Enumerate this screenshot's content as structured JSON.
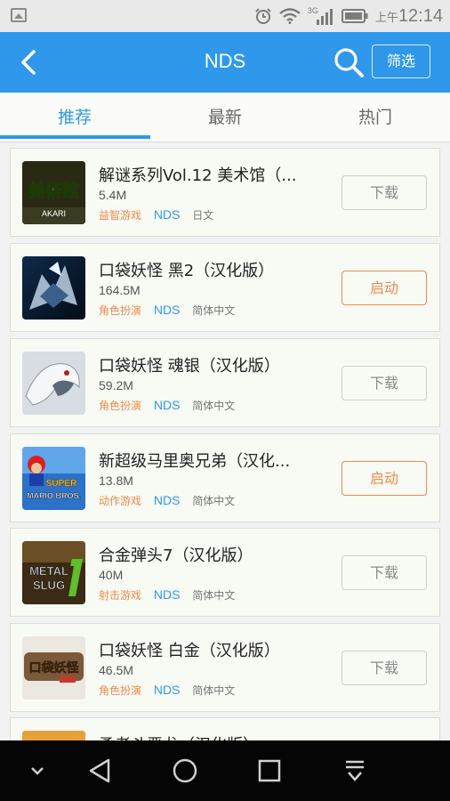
{
  "status_bar": {
    "ampm": "上午",
    "time": "12:14",
    "network": "3G"
  },
  "app_bar": {
    "title": "NDS",
    "filter_label": "筛选"
  },
  "tabs": [
    {
      "label": "推荐",
      "active": true
    },
    {
      "label": "最新",
      "active": false
    },
    {
      "label": "热门",
      "active": false
    }
  ],
  "games": [
    {
      "name": "解谜系列Vol.12 美术馆（...",
      "size": "5.4M",
      "category": "益智游戏",
      "platform": "NDS",
      "language": "日文",
      "action": "下载",
      "action_type": "download",
      "thumb": "akari-museum",
      "thumb_text": "美術館",
      "thumb_sub": "AKARI"
    },
    {
      "name": "口袋妖怪 黑2（汉化版）",
      "size": "164.5M",
      "category": "角色扮演",
      "platform": "NDS",
      "language": "简体中文",
      "action": "启动",
      "action_type": "launch",
      "thumb": "pokemon-black2"
    },
    {
      "name": "口袋妖怪 魂银（汉化版）",
      "size": "59.2M",
      "category": "角色扮演",
      "platform": "NDS",
      "language": "简体中文",
      "action": "下载",
      "action_type": "download",
      "thumb": "pokemon-soulsilver"
    },
    {
      "name": "新超级马里奥兄弟（汉化...",
      "size": "13.8M",
      "category": "动作游戏",
      "platform": "NDS",
      "language": "简体中文",
      "action": "启动",
      "action_type": "launch",
      "thumb": "new-super-mario",
      "thumb_text": "SUPER",
      "thumb_sub": "MARIO BROS."
    },
    {
      "name": "合金弹头7（汉化版）",
      "size": "40M",
      "category": "射击游戏",
      "platform": "NDS",
      "language": "简体中文",
      "action": "下载",
      "action_type": "download",
      "thumb": "metal-slug-7",
      "thumb_text": "METAL",
      "thumb_sub": "SLUG"
    },
    {
      "name": "口袋妖怪 白金（汉化版）",
      "size": "46.5M",
      "category": "角色扮演",
      "platform": "NDS",
      "language": "简体中文",
      "action": "下载",
      "action_type": "download",
      "thumb": "pokemon-platinum",
      "thumb_text": "口袋妖怪"
    },
    {
      "name": "勇者斗恶龙（汉化版）",
      "size": "",
      "category": "",
      "platform": "",
      "language": "",
      "action": "",
      "action_type": "download",
      "thumb": "partial-game"
    }
  ],
  "colors": {
    "primary": "#2f98ea",
    "accent_orange": "#f08a4b",
    "background": "#f2f2f2",
    "card": "#f8faf4"
  }
}
